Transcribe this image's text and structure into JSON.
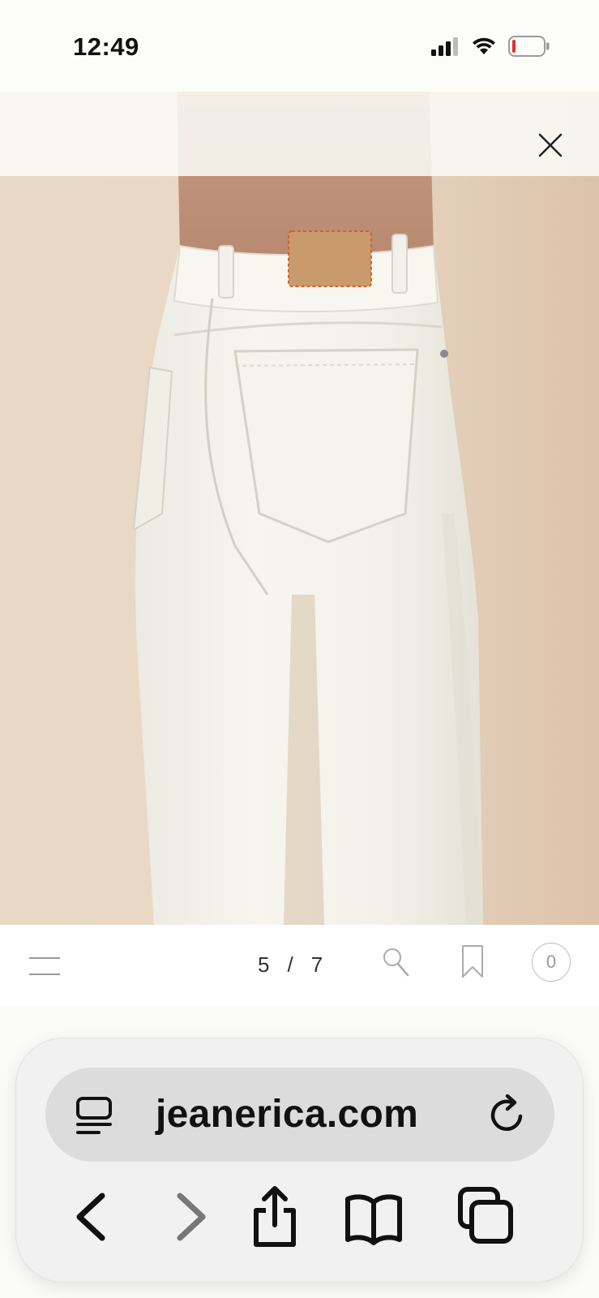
{
  "status_bar": {
    "time": "12:49",
    "icons": [
      "cellular-signal-icon",
      "wifi-icon",
      "battery-low-icon"
    ],
    "battery_color": "#e0312f"
  },
  "gallery": {
    "close_icon": "close-icon",
    "current": "5",
    "separator": "/",
    "total": "7",
    "backdrop_color": "#e7d6c4",
    "product_color": "#f4f3ea"
  },
  "site_nav": {
    "menu_icon": "menu-icon",
    "search_icon": "search-icon",
    "bookmark_icon": "bookmark-icon",
    "cart_count": "0"
  },
  "browser": {
    "url": "jeanerica.com",
    "reader_icon": "reader-mode-icon",
    "reload_icon": "reload-icon",
    "toolbar": [
      "back-icon",
      "forward-icon",
      "share-icon",
      "bookmarks-icon",
      "tabs-icon"
    ]
  }
}
